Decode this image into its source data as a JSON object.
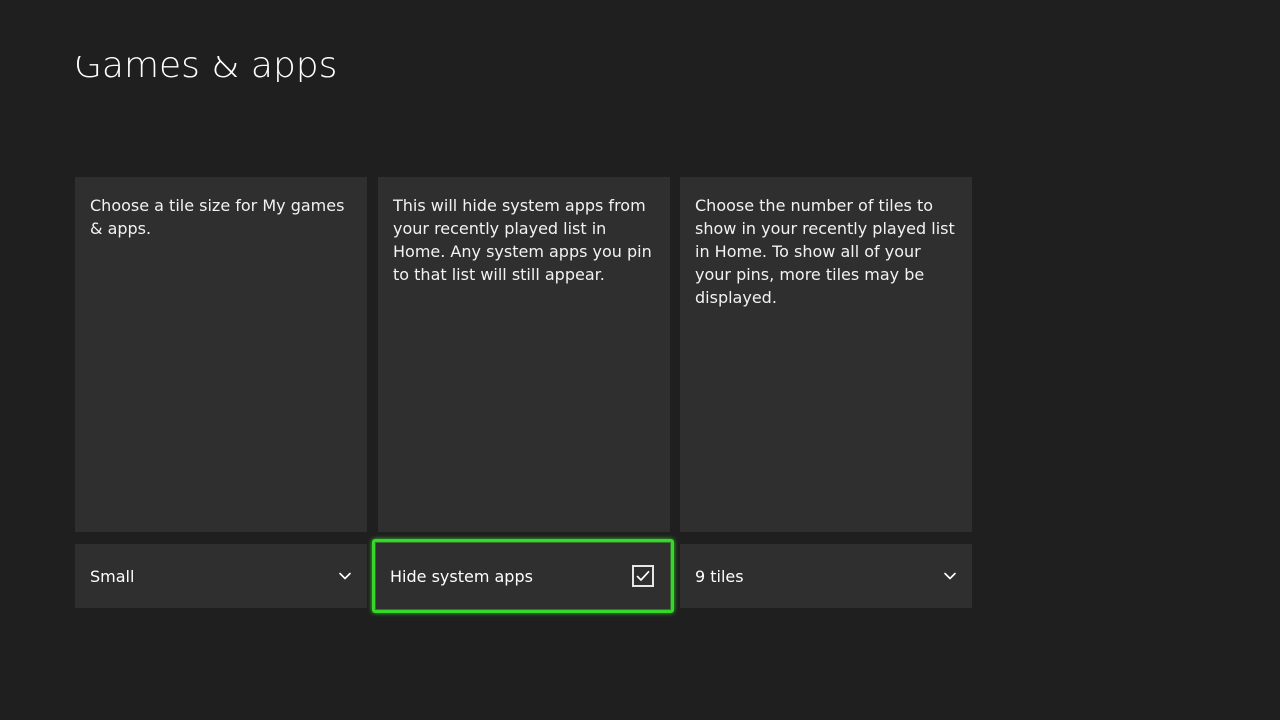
{
  "page": {
    "title": "Games & apps"
  },
  "panels": [
    {
      "description": "Choose a tile size for My games & apps.",
      "control_value": "Small",
      "control_icon": "chevron-down-icon"
    },
    {
      "description": "This will hide system apps from your recently played list in Home. Any system apps you pin to that list will still appear.",
      "control_value": "Hide system apps",
      "control_icon": "checkbox-checked-icon",
      "checked": true
    },
    {
      "description": "Choose the number of tiles to show in your recently played list in Home. To show all of your your pins, more tiles may be displayed.",
      "control_value": "9 tiles",
      "control_icon": "chevron-down-icon"
    }
  ],
  "colors": {
    "background": "#1f1f1f",
    "panel": "#2f2f2f",
    "focus": "#36d62a",
    "text": "#ffffff"
  }
}
